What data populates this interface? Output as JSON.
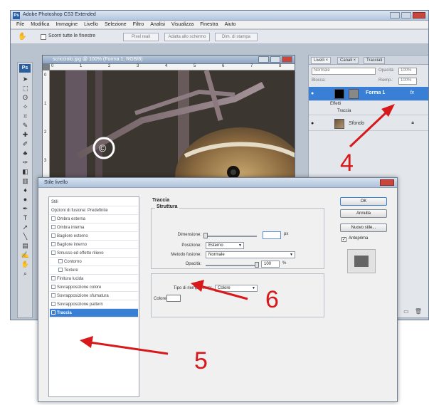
{
  "app": {
    "title": "Adobe Photoshop CS3 Extended",
    "menu": [
      "File",
      "Modifica",
      "Immagine",
      "Livello",
      "Selezione",
      "Filtro",
      "Analisi",
      "Visualizza",
      "Finestra",
      "Aiuto"
    ],
    "options": {
      "scroll_all_label": "Scorri tutte le finestre",
      "real_pixels": "Pixel reali",
      "fit_screen": "Adatta allo schermo",
      "print_size": "Dim. di stampa"
    },
    "badge": "Ps"
  },
  "document": {
    "title": "scricciolo.jpg @ 100% (Forma 1, RGB/8)",
    "ruler_top": [
      "0",
      "1",
      "2",
      "3",
      "4",
      "5",
      "6",
      "7",
      "8"
    ],
    "ruler_left": [
      "0",
      "1",
      "2",
      "3"
    ],
    "watermark": "©"
  },
  "layers_panel": {
    "tabs": [
      "Livelli ×",
      "Canali ×",
      "Tracciati"
    ],
    "blend_mode": "Normale",
    "opacity_label": "Opacità:",
    "opacity_value": "100%",
    "lock_label": "Blocca:",
    "fill_label": "Riemp.:",
    "fill_value": "100%",
    "layers": [
      {
        "name": "Forma 1",
        "fx": "fx"
      },
      {
        "name": "Effetti"
      },
      {
        "name": "Traccia"
      },
      {
        "name": "Sfondo"
      }
    ]
  },
  "dialog": {
    "title": "Stile livello",
    "styles_list": [
      {
        "label": "Stili",
        "checkbox": false,
        "sub": false
      },
      {
        "label": "Opzioni di fusione: Predefinite",
        "checkbox": false,
        "sub": false
      },
      {
        "label": "Ombra esterna",
        "checkbox": true,
        "sub": false
      },
      {
        "label": "Ombra interna",
        "checkbox": true,
        "sub": false
      },
      {
        "label": "Bagliore esterno",
        "checkbox": true,
        "sub": false
      },
      {
        "label": "Bagliore interno",
        "checkbox": true,
        "sub": false
      },
      {
        "label": "Smusso ed effetto rilievo",
        "checkbox": true,
        "sub": false
      },
      {
        "label": "Contorno",
        "checkbox": true,
        "sub": true
      },
      {
        "label": "Texture",
        "checkbox": true,
        "sub": true
      },
      {
        "label": "Finitura lucida",
        "checkbox": true,
        "sub": false
      },
      {
        "label": "Sovrapposizione colore",
        "checkbox": true,
        "sub": false
      },
      {
        "label": "Sovrapposizione sfumatura",
        "checkbox": true,
        "sub": false
      },
      {
        "label": "Sovrapposizione pattern",
        "checkbox": true,
        "sub": false
      },
      {
        "label": "Traccia",
        "checkbox": true,
        "sub": false,
        "selected": true
      }
    ],
    "stroke": {
      "heading": "Traccia",
      "structure_legend": "Struttura",
      "size_label": "Dimensione:",
      "size_unit": "px",
      "position_label": "Posizione:",
      "position_value": "Esterno",
      "blend_label": "Metodo fusione:",
      "blend_value": "Normale",
      "opacity_label": "Opacità:",
      "opacity_value": "100",
      "opacity_unit": "%",
      "size_fraction": 0.0,
      "opacity_fraction": 1.0,
      "fill_type_label": "Tipo di riempimento:",
      "fill_type_value": "Colore",
      "color_label": "Colore:"
    },
    "buttons": {
      "ok": "OK",
      "cancel": "Annulla",
      "new_style": "Nuovo stile...",
      "preview": "Anteprima"
    }
  },
  "annotations": {
    "step_4": "4",
    "step_5": "5",
    "step_6": "6",
    "arrow_color": "#d8181a"
  }
}
